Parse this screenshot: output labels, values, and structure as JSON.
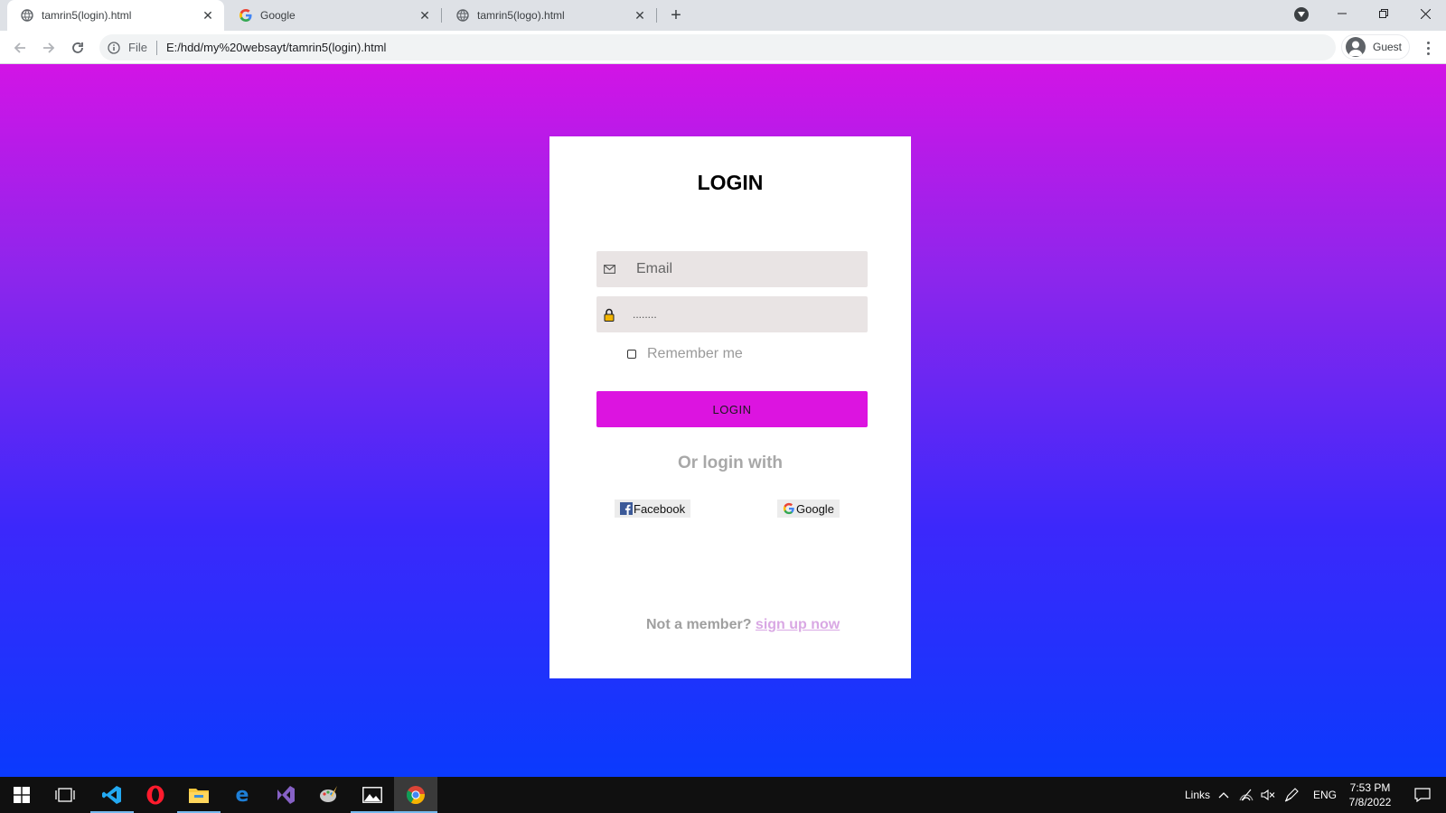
{
  "browser": {
    "tabs": [
      {
        "title": "tamrin5(login).html",
        "active": true,
        "favicon": "globe-icon"
      },
      {
        "title": "Google",
        "active": false,
        "favicon": "google-icon"
      },
      {
        "title": "tamrin5(logo).html",
        "active": false,
        "favicon": "globe-icon"
      }
    ],
    "address": {
      "scheme_label": "File",
      "url": "E:/hdd/my%20websayt/tamrin5(login).html"
    },
    "profile_label": "Guest"
  },
  "page": {
    "background_gradient": [
      "#d214e6",
      "#0a3afd"
    ],
    "accent": "#dc14e0",
    "title": "LOGIN",
    "email_placeholder": "Email",
    "password_mask": "........",
    "remember_label": "Remember me",
    "login_button": "LOGIN",
    "or_login_with": "Or login with",
    "social": [
      {
        "label": "Facebook",
        "icon": "facebook-icon"
      },
      {
        "label": "Google",
        "icon": "google-icon"
      }
    ],
    "not_member": "Not a member?",
    "signup_link": "sign up now"
  },
  "taskbar": {
    "apps": [
      "windows-start",
      "task-view",
      "vscode",
      "opera",
      "file-explorer",
      "edge",
      "visual-studio",
      "paint",
      "photos",
      "chrome"
    ],
    "links_label": "Links",
    "language": "ENG",
    "time": "7:53 PM",
    "date": "7/8/2022"
  }
}
